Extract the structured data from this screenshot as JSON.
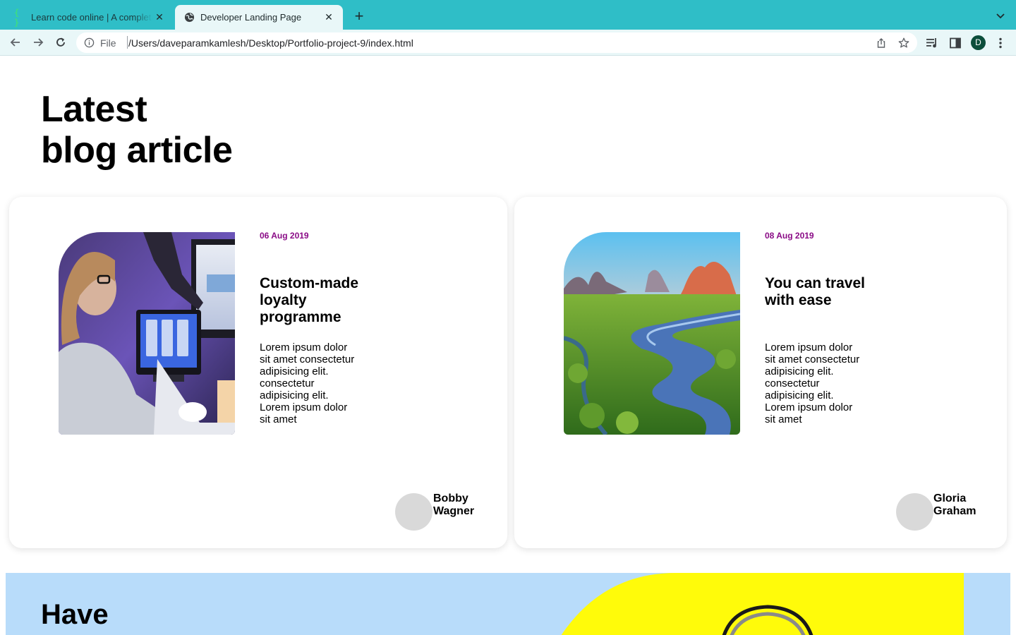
{
  "browser": {
    "tabs": [
      {
        "title": "Learn code online | A complete",
        "icon": "braces-icon",
        "active": false
      },
      {
        "title": "Developer Landing Page",
        "icon": "globe-icon",
        "active": true
      }
    ],
    "address": {
      "scheme_label": "File",
      "url": "/Users/daveparamkamlesh/Desktop/Portfolio-project-9/index.html"
    },
    "profile_initial": "D",
    "colors": {
      "tab_strip": "#2fbec7",
      "toolbar": "#e9f7f8",
      "profile": "#0c4e3b"
    }
  },
  "page": {
    "heading_line1": "Latest",
    "heading_line2": "blog article",
    "articles": [
      {
        "date": "06 Aug 2019",
        "title": "Custom-made loyalty programme",
        "excerpt": "Lorem ipsum dolor sit amet consectetur adipisicing elit. consectetur adipisicing elit. Lorem ipsum dolor sit amet",
        "author": "Bobby Wagner",
        "image": "developer-at-monitors-photo"
      },
      {
        "date": "08 Aug 2019",
        "title": "You can travel with ease",
        "excerpt": "Lorem ipsum dolor sit amet consectetur adipisicing elit. consectetur adipisicing elit. Lorem ipsum dolor sit amet",
        "author": "Gloria Graham",
        "image": "river-landscape-photo"
      }
    ],
    "cta_title": "Have",
    "colors": {
      "date": "#8a0b86",
      "cta_background": "#b8dcfa",
      "cta_image_yellow": "#fffb0a"
    }
  }
}
